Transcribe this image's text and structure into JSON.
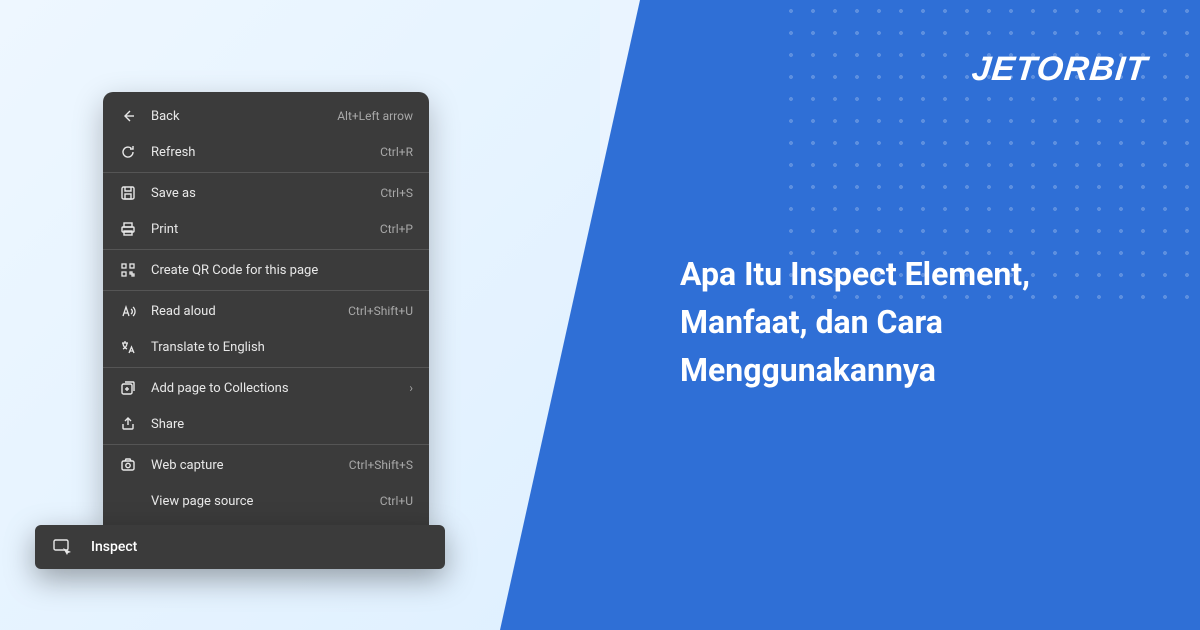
{
  "brand": {
    "name": "JETORBIT"
  },
  "heading": "Apa Itu Inspect Element, Manfaat, dan Cara Menggunakannya",
  "menu": {
    "groups": [
      [
        {
          "icon": "back",
          "label": "Back",
          "shortcut": "Alt+Left arrow"
        },
        {
          "icon": "refresh",
          "label": "Refresh",
          "shortcut": "Ctrl+R"
        }
      ],
      [
        {
          "icon": "save",
          "label": "Save as",
          "shortcut": "Ctrl+S"
        },
        {
          "icon": "print",
          "label": "Print",
          "shortcut": "Ctrl+P"
        }
      ],
      [
        {
          "icon": "qr",
          "label": "Create QR Code for this page",
          "shortcut": ""
        }
      ],
      [
        {
          "icon": "read-aloud",
          "label": "Read aloud",
          "shortcut": "Ctrl+Shift+U"
        },
        {
          "icon": "translate",
          "label": "Translate to English",
          "shortcut": ""
        }
      ],
      [
        {
          "icon": "collections",
          "label": "Add page to Collections",
          "shortcut": "",
          "submenu": true
        },
        {
          "icon": "share",
          "label": "Share",
          "shortcut": ""
        }
      ],
      [
        {
          "icon": "web-capture",
          "label": "Web capture",
          "shortcut": "Ctrl+Shift+S"
        },
        {
          "icon": "none",
          "label": "View page source",
          "shortcut": "Ctrl+U"
        }
      ]
    ]
  },
  "inspect": {
    "label": "Inspect"
  }
}
